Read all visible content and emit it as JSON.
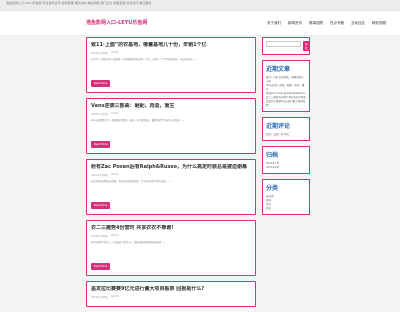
{
  "topbar": {
    "text": "浩鱼影网入口-LEYU乐鱼网 专注体育资讯 最新赛事 球队动态 精彩视频 热门比分 赛事直播 欢迎访问 每日更新"
  },
  "site": {
    "logo": "浩鱼影网入口-LEYU乐鱼网"
  },
  "nav": [
    "关于我们",
    "新闻资讯",
    "赛事回顾",
    "热点专题",
    "互动社区",
    "精彩视频"
  ],
  "posts": [
    {
      "title": "致11·上面”的农基地，哪量基地几十份，年销1个亿",
      "meta": [
        "2021年7月8日",
        "admin"
      ],
      "excerpt": "关于11·上面的农产品基地，年销售额已经达到一个亿，这是一个了不起的成就，来自各地的……",
      "button": "Read More"
    },
    {
      "title": "Vans逆袭三部曲：砸配，再造，重生",
      "meta": [
        "2021年7月8日",
        "admin"
      ],
      "excerpt": "Vans品牌经历了一段艰难的时期，通过一系列的改革，重新赢得了年轻人的喜爱……",
      "button": "Read More"
    },
    {
      "title": "射有Zac Posen后有Ralph&Russo，为什么高定时装总是被迫谢幕",
      "meta": [
        "2021年7月8日",
        "admin"
      ],
      "excerpt": "高定时装品牌接连谢幕，背后原因值得深思，行业正在经历新的变化……",
      "button": "Read More"
    },
    {
      "title": "衣二三撒势4份营时 共享衣衣不尊谢!",
      "meta": [
        "2021年7月8日",
        "admin"
      ],
      "excerpt": "共享衣橱平台衣二三的发展引发关注，其商业模式面临新的挑战……",
      "button": "Read More"
    },
    {
      "title": "盖发拉比赛赛9亿元进行量大项目般票 回报是什么?",
      "meta": [
        "2021年7月8日",
        "admin"
      ],
      "excerpt": "",
      "button": "Read More"
    }
  ],
  "sidebar": {
    "search": {
      "placeholder": "",
      "button": "搜索"
    },
    "recent_title": "近期文章",
    "recent": [
      "致11·上面”的农基地，哪量基地几十份",
      "Vans逆袭三部曲：砸配，再造，重生",
      "射有Zac Posen后有Ralph&Russo",
      "衣二三撒势4份营时 共享衣衣不尊谢",
      "盖发拉比赛赛9亿元进行量大项目般票"
    ],
    "comments_title": "近期评论",
    "comments": [
      "您好，这是一条评论。"
    ],
    "archive_title": "归档",
    "archive": [
      "2021年7月",
      "2021年6月"
    ],
    "category_title": "分类",
    "categories": [
      "未分类",
      "新闻",
      "资讯",
      "体育"
    ]
  }
}
